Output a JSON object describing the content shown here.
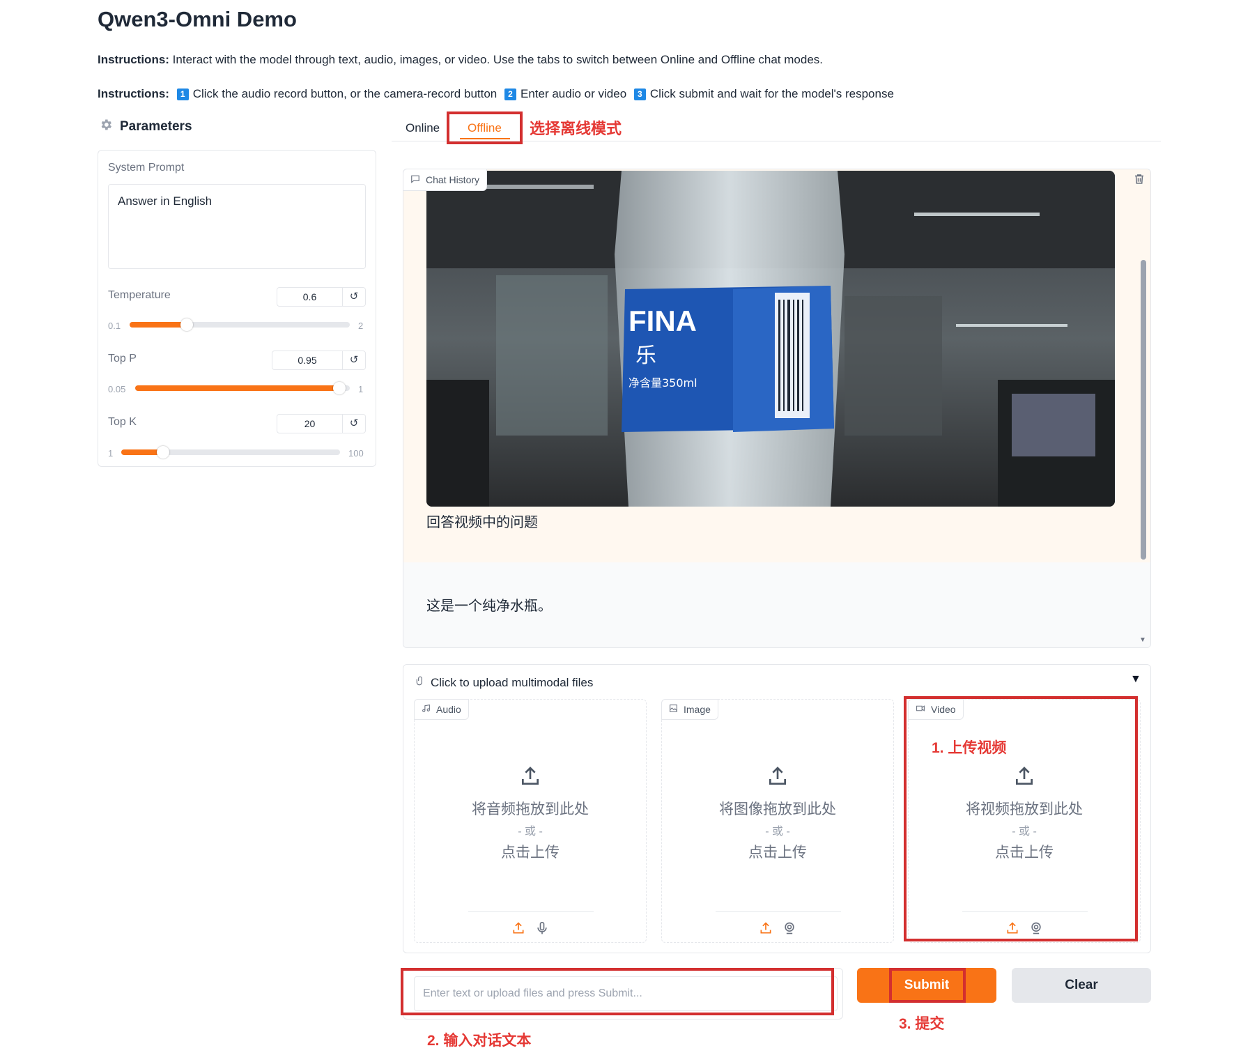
{
  "app": {
    "title": "Qwen3-Omni Demo"
  },
  "instructions1": {
    "label": "Instructions:",
    "text": " Interact with the model through text, audio, images, or video. Use the tabs to switch between Online and Offline chat modes."
  },
  "instructions2": {
    "label": "Instructions:",
    "steps": [
      {
        "num": "1",
        "text": "Click the audio record button, or the camera-record button"
      },
      {
        "num": "2",
        "text": "Enter audio or video"
      },
      {
        "num": "3",
        "text": "Click submit and wait for the model's response"
      }
    ]
  },
  "params": {
    "title": "Parameters",
    "system_prompt_label": "System Prompt",
    "system_prompt_value": "Answer in English",
    "temperature": {
      "label": "Temperature",
      "value": "0.6",
      "min": "0.1",
      "max": "2",
      "fraction": 0.26
    },
    "top_p": {
      "label": "Top P",
      "value": "0.95",
      "min": "0.05",
      "max": "1",
      "fraction": 0.95
    },
    "top_k": {
      "label": "Top K",
      "value": "20",
      "min": "1",
      "max": "100",
      "fraction": 0.19
    },
    "reset_glyph": "↺"
  },
  "tabs": {
    "online": "Online",
    "offline": "Offline",
    "annotation": "选择离线模式"
  },
  "chat": {
    "label": "Chat History",
    "user_message": "回答视频中的问题",
    "bot_message": "这是一个纯净水瓶。",
    "video_bottle_text": "FINA",
    "video_bottle_sub": "乐",
    "video_bottle_vol": "净含量350ml"
  },
  "upload": {
    "header": "Click to upload multimodal files",
    "audio": {
      "label": "Audio",
      "drop": "将音频拖放到此处",
      "or": "- 或 -",
      "click": "点击上传"
    },
    "image": {
      "label": "Image",
      "drop": "将图像拖放到此处",
      "or": "- 或 -",
      "click": "点击上传"
    },
    "video": {
      "label": "Video",
      "drop": "将视频拖放到此处",
      "or": "- 或 -",
      "click": "点击上传"
    },
    "video_annotation": "1. 上传视频"
  },
  "input": {
    "placeholder": "Enter text or upload files and press Submit...",
    "annotation": "2. 输入对话文本"
  },
  "buttons": {
    "submit": "Submit",
    "clear": "Clear",
    "submit_annotation": "3. 提交"
  },
  "colors": {
    "accent": "#f97316",
    "annotation_red": "#d32f2f",
    "step_blue": "#1e88e5"
  }
}
